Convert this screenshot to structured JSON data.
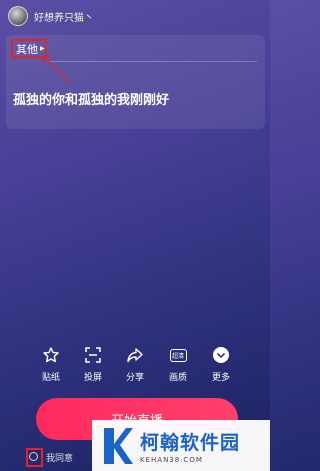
{
  "header": {
    "username": "好想养只猫丶"
  },
  "panel": {
    "category_label": "其他",
    "live_title": "孤独的你和孤独的我刚刚好"
  },
  "toolbar": {
    "items": [
      {
        "label": "贴纸",
        "icon": "sticker-icon"
      },
      {
        "label": "投屏",
        "icon": "cast-screen-icon"
      },
      {
        "label": "分享",
        "icon": "share-icon"
      },
      {
        "label": "画质",
        "icon": "quality-hd-icon",
        "badge": "超清"
      },
      {
        "label": "更多",
        "icon": "more-chevron-icon"
      }
    ]
  },
  "start_button": {
    "label": "开始直播"
  },
  "agreement": {
    "text": "我同意"
  },
  "watermark": {
    "name": "柯翰软件园",
    "url": "KEHAN38.COM"
  },
  "colors": {
    "highlight": "#e3232c",
    "start_button": "#ff2a5e",
    "watermark_brand": "#1a63c9"
  }
}
